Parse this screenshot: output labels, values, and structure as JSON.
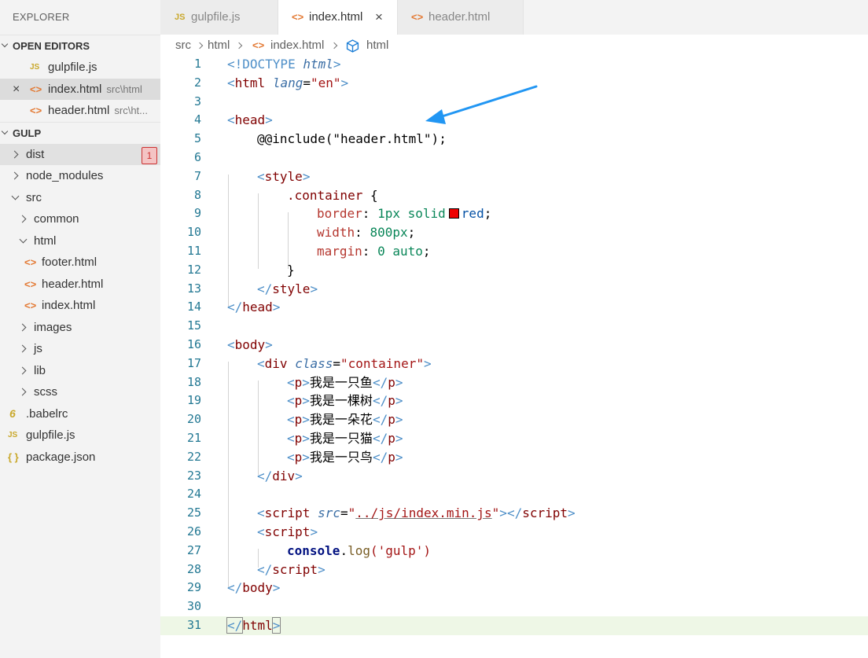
{
  "explorer": {
    "title": "EXPLORER",
    "open_editors": {
      "label": "OPEN EDITORS",
      "items": [
        {
          "name": "gulpfile.js",
          "desc": "",
          "icon": "js-file-icon"
        },
        {
          "name": "index.html",
          "desc": "src\\html",
          "icon": "html-file-icon"
        },
        {
          "name": "header.html",
          "desc": "src\\ht...",
          "icon": "html-file-icon"
        }
      ]
    },
    "workspace": {
      "label": "GULP",
      "dist_badge": "1",
      "items": [
        {
          "name": "dist"
        },
        {
          "name": "node_modules"
        },
        {
          "name": "src"
        },
        {
          "name": "common"
        },
        {
          "name": "html"
        },
        {
          "name": "footer.html"
        },
        {
          "name": "header.html"
        },
        {
          "name": "index.html"
        },
        {
          "name": "images"
        },
        {
          "name": "js"
        },
        {
          "name": "lib"
        },
        {
          "name": "scss"
        },
        {
          "name": ".babelrc"
        },
        {
          "name": "gulpfile.js"
        },
        {
          "name": "package.json"
        }
      ]
    }
  },
  "tabs": [
    {
      "label": "gulpfile.js",
      "icon": "js-file-icon",
      "active": false
    },
    {
      "label": "index.html",
      "icon": "html-file-icon",
      "active": true
    },
    {
      "label": "header.html",
      "icon": "html-file-icon",
      "active": false
    }
  ],
  "icons": {
    "js_glyph": "JS",
    "html_glyph": "<>",
    "close_glyph": "×",
    "babel_glyph": "6",
    "json_glyph": "{ }"
  },
  "breadcrumb": [
    "src",
    "html",
    "index.html",
    "html"
  ],
  "code": {
    "line_numbers": [
      "1",
      "2",
      "3",
      "4",
      "5",
      "6",
      "7",
      "8",
      "9",
      "10",
      "11",
      "12",
      "13",
      "14",
      "15",
      "16",
      "17",
      "18",
      "19",
      "20",
      "21",
      "22",
      "23",
      "24",
      "25",
      "26",
      "27",
      "28",
      "29",
      "30",
      "31"
    ],
    "tokens": {
      "doctype_open": "<!DOCTYPE",
      "doctype_html": "html",
      "gt": ">",
      "lt": "<",
      "lt_slash": "</",
      "eq": "=",
      "html": "html",
      "lang": "lang",
      "lang_val": "\"en\"",
      "head": "head",
      "include": "@@include(\"header.html\");",
      "style": "style",
      "selector": ".container",
      "brace_open": "{",
      "brace_close": "}",
      "border_prop": "border",
      "colon": ":",
      "border_num": "1px",
      "border_kw": "solid",
      "border_color": "red",
      "semi": ";",
      "width_prop": "width",
      "width_num": "800px",
      "margin_prop": "margin",
      "margin_num": "0",
      "margin_kw": "auto",
      "body": "body",
      "div": "div",
      "class": "class",
      "class_val": "\"container\"",
      "p": "p",
      "p1": "我是一只鱼",
      "p2": "我是一棵树",
      "p3": "我是一朵花",
      "p4": "我是一只猫",
      "p5": "我是一只鸟",
      "script": "script",
      "src": "src",
      "quote": "\"",
      "src_val": "../js/index.min.js",
      "console": "console",
      "dot": ".",
      "log": "log",
      "log_args": "('gulp')"
    }
  },
  "colors": {
    "accent_arrow": "#2196f3",
    "badge_error": "#cc3333"
  }
}
